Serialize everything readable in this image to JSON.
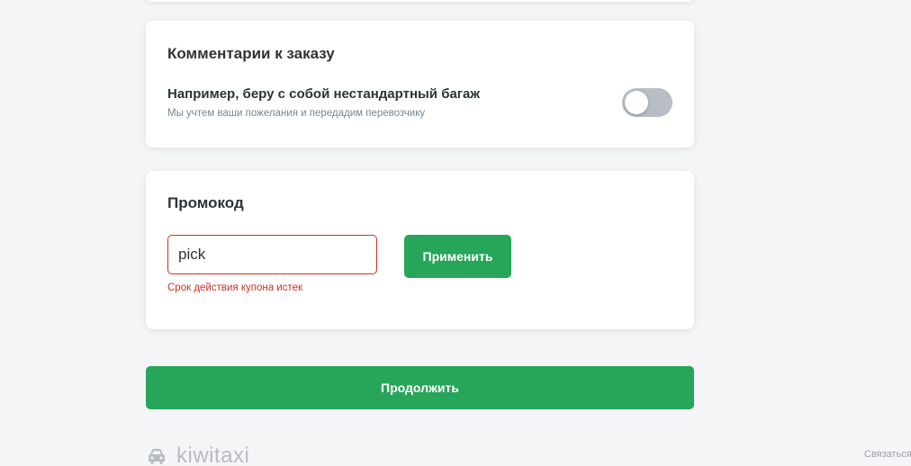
{
  "comments": {
    "title": "Комментарии к заказу",
    "toggle_label": "Например, беру с собой нестандартный багаж",
    "toggle_hint": "Мы учтем ваши пожелания и передадим перевозчику",
    "toggle_on": false
  },
  "promo": {
    "title": "Промокод",
    "input_value": "pick",
    "error_text": "Срок действия купона истек",
    "apply_label": "Применить"
  },
  "continue_label": "Продолжить",
  "footer": {
    "logo_text": "kiwitaxi",
    "logo_icon": "car-icon",
    "contact_label": "Связаться"
  },
  "colors": {
    "accent_green": "#27a55a",
    "error_red": "#d0311f",
    "toggle_off": "#b9bec6"
  }
}
